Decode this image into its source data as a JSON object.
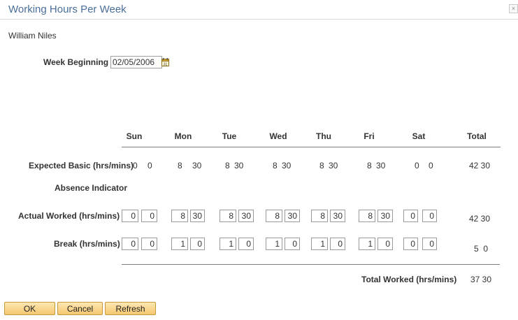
{
  "window": {
    "title": "Working Hours Per Week"
  },
  "employee": {
    "name": "William Niles"
  },
  "week": {
    "label": "Week Beginning",
    "value": "02/05/2006",
    "calendar_icon": "calendar-icon"
  },
  "columns": {
    "days": [
      "Sun",
      "Mon",
      "Tue",
      "Wed",
      "Thu",
      "Fri",
      "Sat"
    ],
    "total": "Total"
  },
  "rows": {
    "expected": {
      "label": "Expected Basic (hrs/mins)",
      "values": [
        [
          "0",
          "0"
        ],
        [
          "8",
          "30"
        ],
        [
          "8",
          "30"
        ],
        [
          "8",
          "30"
        ],
        [
          "8",
          "30"
        ],
        [
          "8",
          "30"
        ],
        [
          "0",
          "0"
        ]
      ],
      "total": "42 30"
    },
    "absence": {
      "label": "Absence Indicator"
    },
    "actual": {
      "label": "Actual Worked (hrs/mins)",
      "values": [
        [
          "0",
          "0"
        ],
        [
          "8",
          "30"
        ],
        [
          "8",
          "30"
        ],
        [
          "8",
          "30"
        ],
        [
          "8",
          "30"
        ],
        [
          "8",
          "30"
        ],
        [
          "0",
          "0"
        ]
      ],
      "total": "42 30"
    },
    "break": {
      "label": "Break (hrs/mins)",
      "values": [
        [
          "0",
          "0"
        ],
        [
          "1",
          "0"
        ],
        [
          "1",
          "0"
        ],
        [
          "1",
          "0"
        ],
        [
          "1",
          "0"
        ],
        [
          "1",
          "0"
        ],
        [
          "0",
          "0"
        ]
      ],
      "total": "5  0"
    }
  },
  "summary": {
    "label": "Total Worked (hrs/mins)",
    "value": "37 30"
  },
  "buttons": {
    "ok": "OK",
    "cancel": "Cancel",
    "refresh": "Refresh"
  }
}
